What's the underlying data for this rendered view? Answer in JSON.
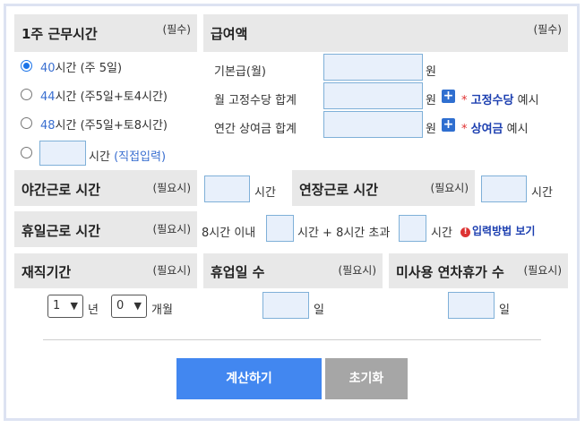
{
  "work_hours": {
    "title": "1주 근무시간",
    "required": "(필수)",
    "options": [
      {
        "hours": "40",
        "unit": "시간",
        "desc": "(주 5일)",
        "selected": true
      },
      {
        "hours": "44",
        "unit": "시간",
        "desc": "(주5일+토4시간)",
        "selected": false
      },
      {
        "hours": "48",
        "unit": "시간",
        "desc": "(주5일+토8시간)",
        "selected": false
      }
    ],
    "custom_unit": "시간",
    "custom_desc": "(직접입력)",
    "custom_value": ""
  },
  "salary": {
    "title": "급여액",
    "required": "(필수)",
    "base_label": "기본급(월)",
    "fixed_label": "월 고정수당 합계",
    "bonus_label": "연간 상여금 합계",
    "currency": "원",
    "plus_symbol": "+",
    "example_star": "*",
    "fixed_example_kw": "고정수당",
    "bonus_example_kw": "상여금",
    "example_suffix": "예시",
    "base_value": "",
    "fixed_value": "",
    "bonus_value": ""
  },
  "night": {
    "title": "야간근로 시간",
    "required": "(필요시)",
    "unit": "시간",
    "value": ""
  },
  "overtime": {
    "title": "연장근로 시간",
    "required": "(필요시)",
    "unit": "시간",
    "value": ""
  },
  "holiday": {
    "title": "휴일근로 시간",
    "required": "(필요시)",
    "within_label": "8시간 이내",
    "mid_label": "시간 + 8시간 초과",
    "unit": "시간",
    "help_icon": "!",
    "help_link": "입력방법 보기",
    "within_value": "",
    "over_value": ""
  },
  "tenure": {
    "title": "재직기간",
    "required": "(필요시)",
    "years_selected": "1",
    "years_unit": "년",
    "months_selected": "0",
    "months_unit": "개월"
  },
  "leave": {
    "title": "휴업일 수",
    "required": "(필요시)",
    "unit": "일",
    "value": ""
  },
  "unused": {
    "title": "미사용 연차휴가 수",
    "required": "(필요시)",
    "unit": "일",
    "value": ""
  },
  "buttons": {
    "calculate": "계산하기",
    "reset": "초기화"
  },
  "colors": {
    "primary": "#4287f0",
    "secondary": "#a6a6a6",
    "header_bg": "#e8e8e8",
    "input_bg": "#e8f0fb"
  }
}
